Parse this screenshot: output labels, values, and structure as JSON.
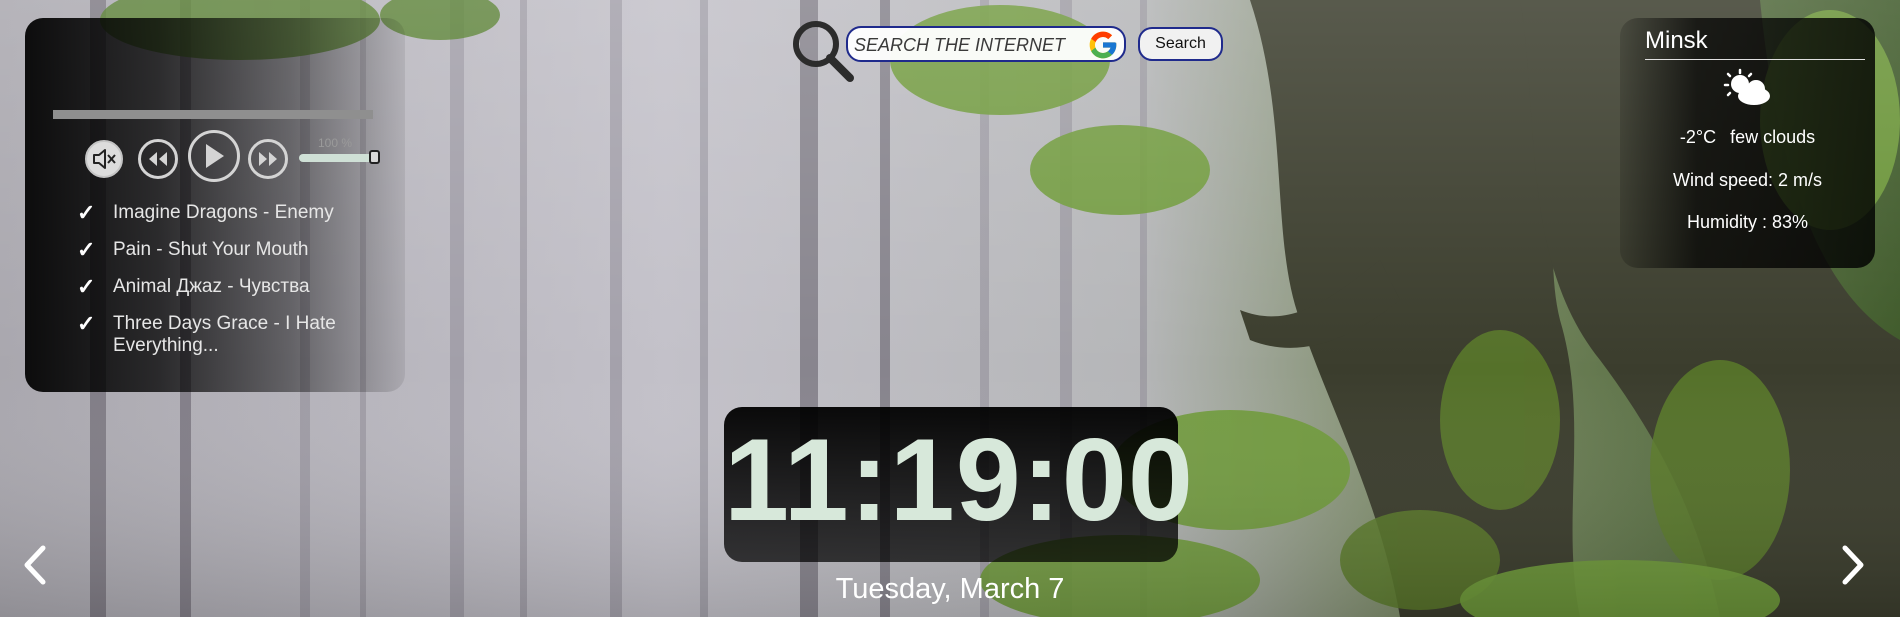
{
  "search": {
    "placeholder": "SEARCH THE INTERNET",
    "button_label": "Search",
    "icons": [
      "magnifier-icon",
      "google-icon"
    ]
  },
  "player": {
    "track_progress": 0,
    "volume_label": "100 %",
    "volume_level": 1.0,
    "controls": [
      "mute-icon",
      "rewind-icon",
      "play-icon",
      "fast-forward-icon"
    ],
    "check_mark": "✓",
    "playlist": [
      "Imagine Dragons - Enemy",
      "Pain - Shut Your Mouth",
      "Animal Джаz - Чувства",
      "Three Days Grace - I Hate Everything..."
    ]
  },
  "weather": {
    "city": "Minsk",
    "icon": "few-clouds-icon",
    "temperature": "-2°C",
    "description": "few clouds",
    "wind": "Wind speed: 2 m/s",
    "humidity": "Humidity : 83%"
  },
  "clock": {
    "time": "11:19:00",
    "date": "Tuesday, March 7"
  },
  "navigation": {
    "prev_icon": "chevron-left-icon",
    "next_icon": "chevron-right-icon"
  },
  "colors": {
    "clock_text": "#d7e8da",
    "search_border": "#1f2a8c",
    "panel_background": "#000000"
  }
}
